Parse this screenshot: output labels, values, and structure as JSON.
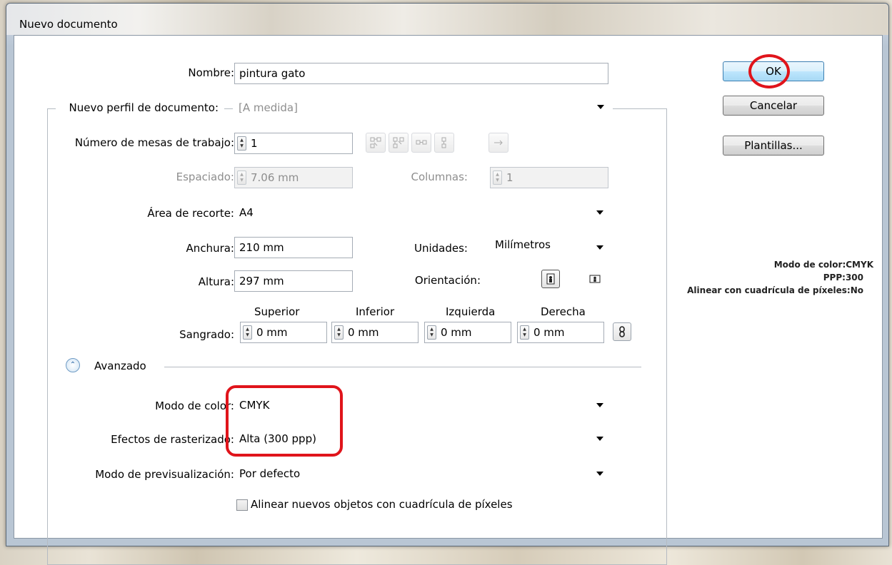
{
  "window": {
    "title": "Nuevo documento"
  },
  "name": {
    "label": "Nombre:",
    "value": "pintura gato"
  },
  "profile": {
    "label": "Nuevo perfil de documento:",
    "value": "[A medida]"
  },
  "artboards": {
    "label": "Número de mesas de trabajo:",
    "value": "1"
  },
  "spacing": {
    "label": "Espaciado:",
    "value": "7.06 mm"
  },
  "columns": {
    "label": "Columnas:",
    "value": "1"
  },
  "crop": {
    "label": "Área de recorte:",
    "value": "A4"
  },
  "width": {
    "label": "Anchura:",
    "value": "210 mm"
  },
  "height": {
    "label": "Altura:",
    "value": "297 mm"
  },
  "units": {
    "label": "Unidades:",
    "value": "Milímetros"
  },
  "orientation": {
    "label": "Orientación:"
  },
  "bleed": {
    "label": "Sangrado:",
    "top_label": "Superior",
    "top_value": "0 mm",
    "bottom_label": "Inferior",
    "bottom_value": "0 mm",
    "left_label": "Izquierda",
    "left_value": "0 mm",
    "right_label": "Derecha",
    "right_value": "0 mm"
  },
  "advanced": {
    "label": "Avanzado"
  },
  "color_mode": {
    "label": "Modo de color:",
    "value": "CMYK"
  },
  "raster": {
    "label": "Efectos de rasterizado:",
    "value": "Alta (300 ppp)"
  },
  "preview": {
    "label": "Modo de previsualización:",
    "value": "Por defecto"
  },
  "align_pixel": {
    "label": "Alinear nuevos objetos con cuadrícula de píxeles",
    "checked": false
  },
  "buttons": {
    "ok": "OK",
    "cancel": "Cancelar",
    "templates": "Plantillas..."
  },
  "info": {
    "color_mode": "Modo de color:CMYK",
    "ppp": "PPP:300",
    "align": "Alinear con cuadrícula de píxeles:No"
  },
  "colors": {
    "annotation_red": "#e0141b",
    "ok_button": "#bee6fd"
  },
  "icons": [
    "grid-by-row-icon",
    "grid-by-column-icon",
    "arrange-by-row-icon",
    "arrange-by-column-icon",
    "left-to-right-icon",
    "portrait-icon",
    "landscape-icon",
    "link-icon",
    "collapse-icon"
  ]
}
